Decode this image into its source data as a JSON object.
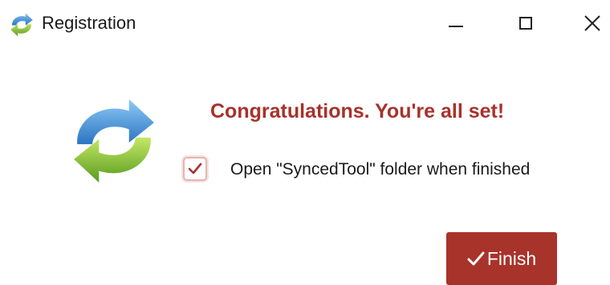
{
  "window": {
    "title": "Registration",
    "icon": "sync-arrows-icon",
    "controls": [
      "minimize",
      "maximize",
      "close"
    ]
  },
  "main": {
    "icon": "sync-arrows-icon",
    "headline": "Congratulations. You're all set!",
    "checkbox": {
      "label": "Open \"SyncedTool\" folder when finished",
      "checked": true
    },
    "finish_button": {
      "label": "Finish",
      "icon": "checkmark-icon"
    }
  },
  "colors": {
    "accent": "#a8332a",
    "headline": "#a6322b",
    "arrow_blue": "#4a90d0",
    "arrow_green": "#7cb530"
  }
}
